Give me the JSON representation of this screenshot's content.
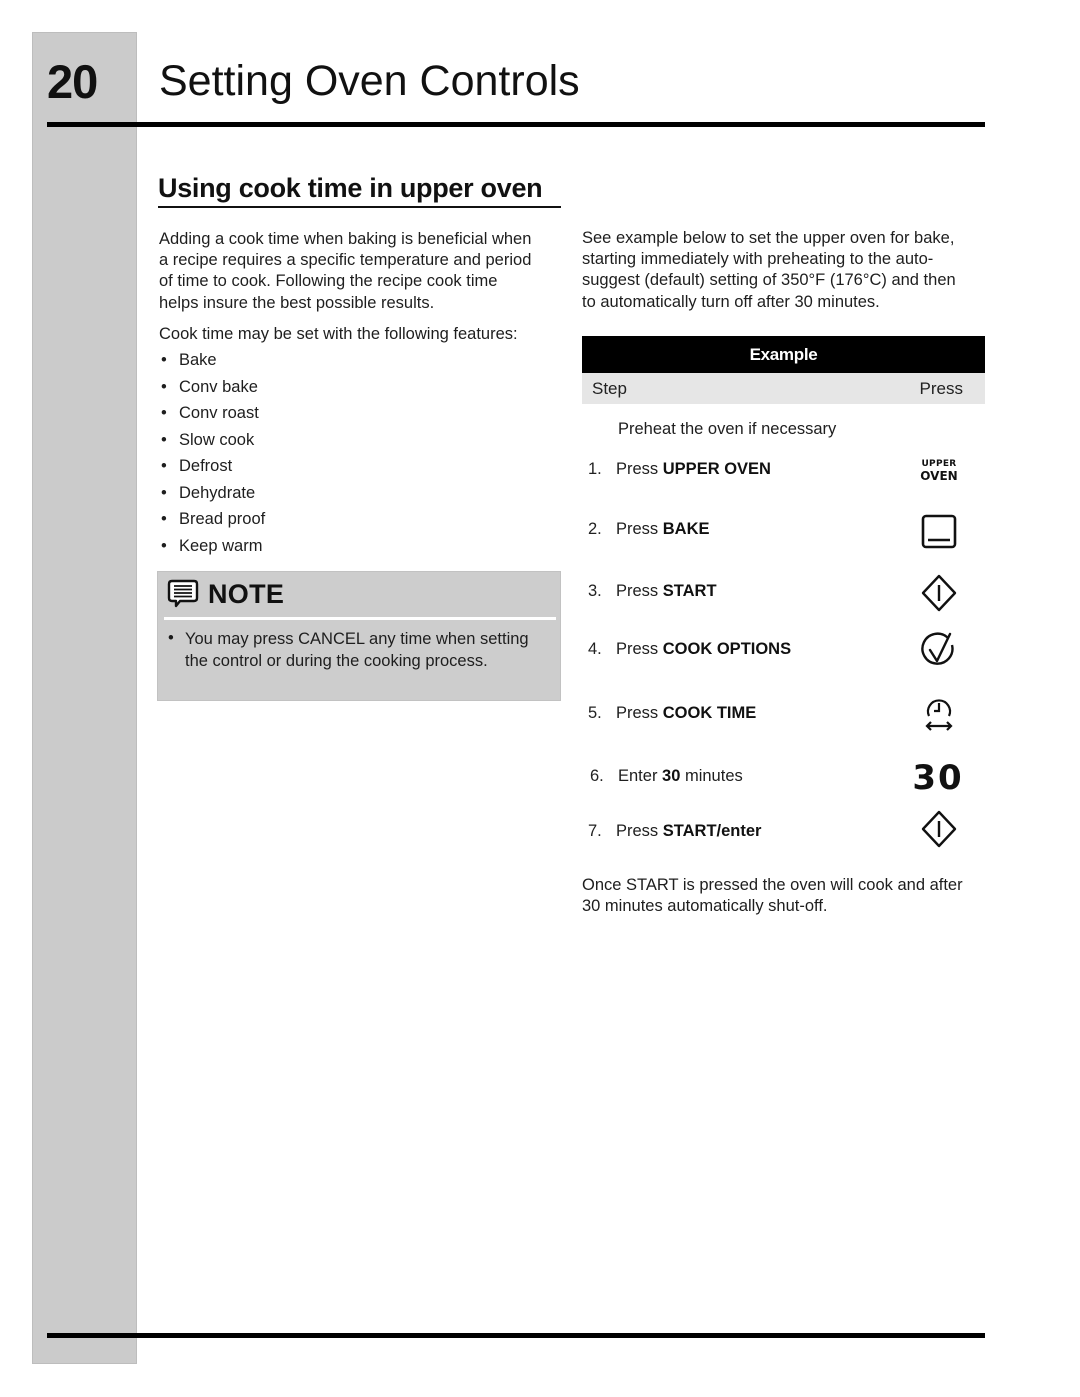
{
  "header": {
    "page_number": "20",
    "title": "Setting Oven Controls"
  },
  "section": {
    "title": "Using cook time in upper oven"
  },
  "left_column": {
    "intro_lines": [
      "Adding a cook time when baking is beneficial when",
      "a recipe requires a specific temperature and period",
      "of time to cook. Following the recipe cook time",
      "helps insure the best possible results."
    ],
    "features_intro": "Cook time may be set with the following features:",
    "bullet": "•",
    "features": [
      "Bake",
      "Conv bake",
      "Conv roast",
      "Slow cook",
      "Defrost",
      "Dehydrate",
      "Bread proof",
      "Keep warm"
    ]
  },
  "note": {
    "icon": "speech-bubble-note-icon",
    "label": "NOTE",
    "bullet": "•",
    "text": "You may press CANCEL any time when setting the control or during the cooking process."
  },
  "right_column": {
    "intro_lines": [
      "See example below to set the upper oven for bake,",
      "starting immediately with preheating to the auto-",
      "suggest (default) setting of 350°F (176°C) and then",
      "to automatically turn off after 30 minutes."
    ]
  },
  "example": {
    "header": "Example",
    "col_step": "Step",
    "col_press": "Press",
    "preheat": "Preheat the oven if necessary",
    "steps": [
      {
        "num": "1.",
        "prefix": "Press ",
        "bold": "UPPER OVEN",
        "suffix": "",
        "icon": "upper-oven-key",
        "key_line1": "UPPER",
        "key_line2": "OVEN"
      },
      {
        "num": "2.",
        "prefix": "Press ",
        "bold": "BAKE",
        "suffix": "",
        "icon": "bake-icon"
      },
      {
        "num": "3.",
        "prefix": "Press ",
        "bold": "START",
        "suffix": "",
        "icon": "start-icon"
      },
      {
        "num": "4.",
        "prefix": "Press ",
        "bold": "COOK OPTIONS",
        "suffix": "",
        "icon": "cook-options-check-icon"
      },
      {
        "num": "5.",
        "prefix": "Press ",
        "bold": "COOK TIME",
        "suffix": "",
        "icon": "cook-time-clock-icon"
      },
      {
        "num": "6.",
        "prefix": "Enter ",
        "bold": "30",
        "suffix": " minutes",
        "icon": "number-keys",
        "key_value": "30"
      },
      {
        "num": "7.",
        "prefix": "Press ",
        "bold": "START/enter",
        "suffix": "",
        "icon": "start-icon"
      }
    ]
  },
  "closing_lines": [
    "Once START is pressed the oven will cook and after",
    "30 minutes automatically shut-off."
  ]
}
